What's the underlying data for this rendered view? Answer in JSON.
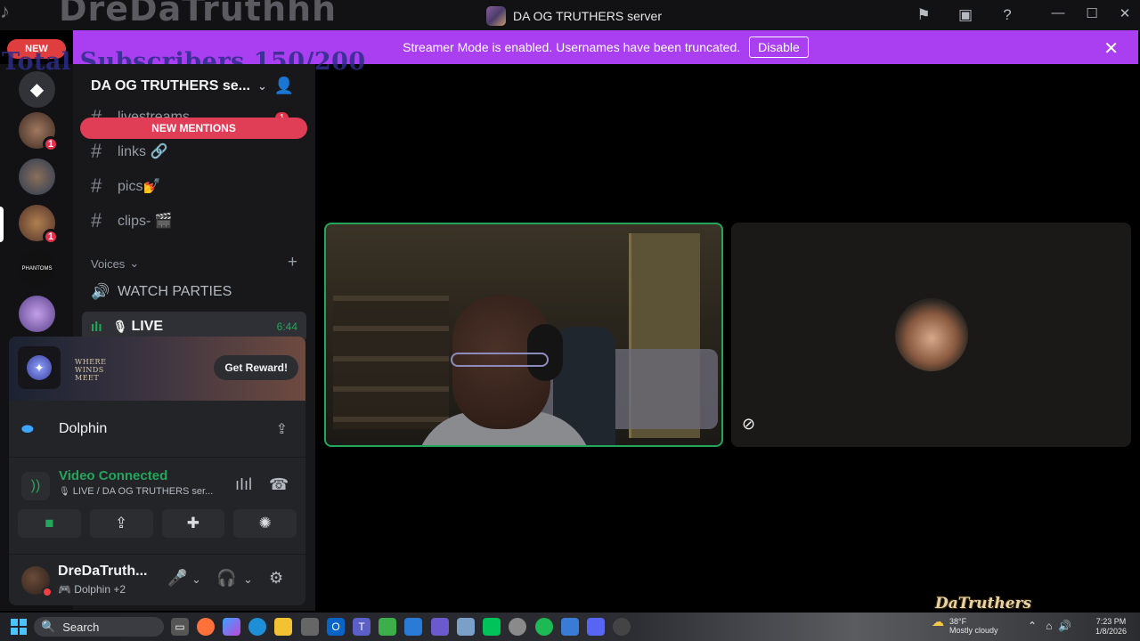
{
  "overlay": {
    "channel_name": "DreDaTruthhh",
    "new_label": "NEW",
    "subs_goal": "Total Subscribers 150/200",
    "watermark": "DaTruthers"
  },
  "titlebar": {
    "server_name": "DA OG TRUTHERS server"
  },
  "banner": {
    "text": "Streamer Mode is enabled. Usernames have been truncated.",
    "disable_label": "Disable"
  },
  "rail": {
    "badges": [
      "1",
      "1"
    ]
  },
  "sidebar": {
    "guild_name": "DA OG TRUTHERS se...",
    "partial_channel": "livestreams",
    "partial_badge": "1",
    "new_mentions": "NEW MENTIONS",
    "channels": [
      {
        "name": "links",
        "emoji": "🔗"
      },
      {
        "name": "pics",
        "emoji": "💅"
      },
      {
        "name": "clips-",
        "emoji": "🎬"
      }
    ],
    "voices_category": "Voices",
    "voice_channels": [
      {
        "name": "WATCH PARTIES"
      },
      {
        "name": "LIVE",
        "time": "6:44"
      }
    ]
  },
  "panel": {
    "promo_game": "WHERE WINDS MEET",
    "reward_label": "Get Reward!",
    "activity_name": "Dolphin",
    "rtc_state": "Video Connected",
    "rtc_channel": "LIVE / DA OG TRUTHERS ser...",
    "username": "DreDaTruth...",
    "user_status": "Dolphin",
    "user_status_extra": "+2"
  },
  "taskbar": {
    "search_label": "Search",
    "temperature": "38°F",
    "weather_desc": "Mostly cloudy",
    "time": "7:23 PM",
    "date": "1/8/2026"
  },
  "colors": {
    "banner": "#a93ff0",
    "connected_green": "#23a55a",
    "mention_red": "#e03e56"
  }
}
